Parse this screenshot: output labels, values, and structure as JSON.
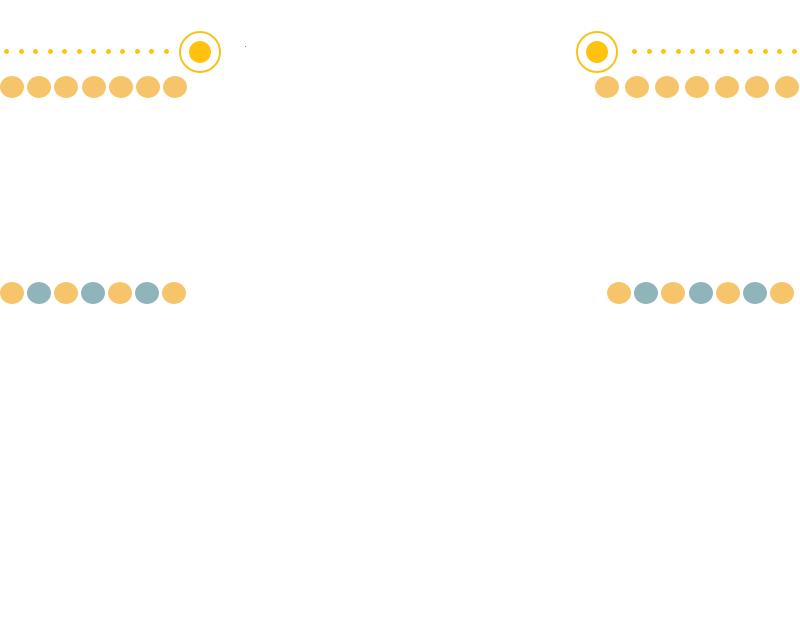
{
  "colors": {
    "accent": "#ffc20e",
    "ring": "#f9c21a",
    "orange": "#f6c56b",
    "teal": "#8fb5ba",
    "mark": "#888888"
  },
  "icons": {
    "target": "target-icon",
    "dot": "dot-icon"
  },
  "groups": [
    {
      "id": "top-left",
      "target_side": "right",
      "small_dot_count": 12,
      "big_dots": [
        "orange",
        "orange",
        "orange",
        "orange",
        "orange",
        "orange",
        "orange"
      ]
    },
    {
      "id": "top-right",
      "target_side": "left",
      "small_dot_count": 12,
      "big_dots": [
        "orange",
        "orange",
        "orange",
        "orange",
        "orange",
        "orange",
        "orange"
      ]
    },
    {
      "id": "middle-left",
      "big_dots": [
        "orange",
        "teal",
        "orange",
        "teal",
        "orange",
        "teal",
        "orange"
      ]
    },
    {
      "id": "middle-right",
      "big_dots": [
        "orange",
        "teal",
        "orange",
        "teal",
        "orange",
        "teal",
        "orange"
      ]
    }
  ]
}
